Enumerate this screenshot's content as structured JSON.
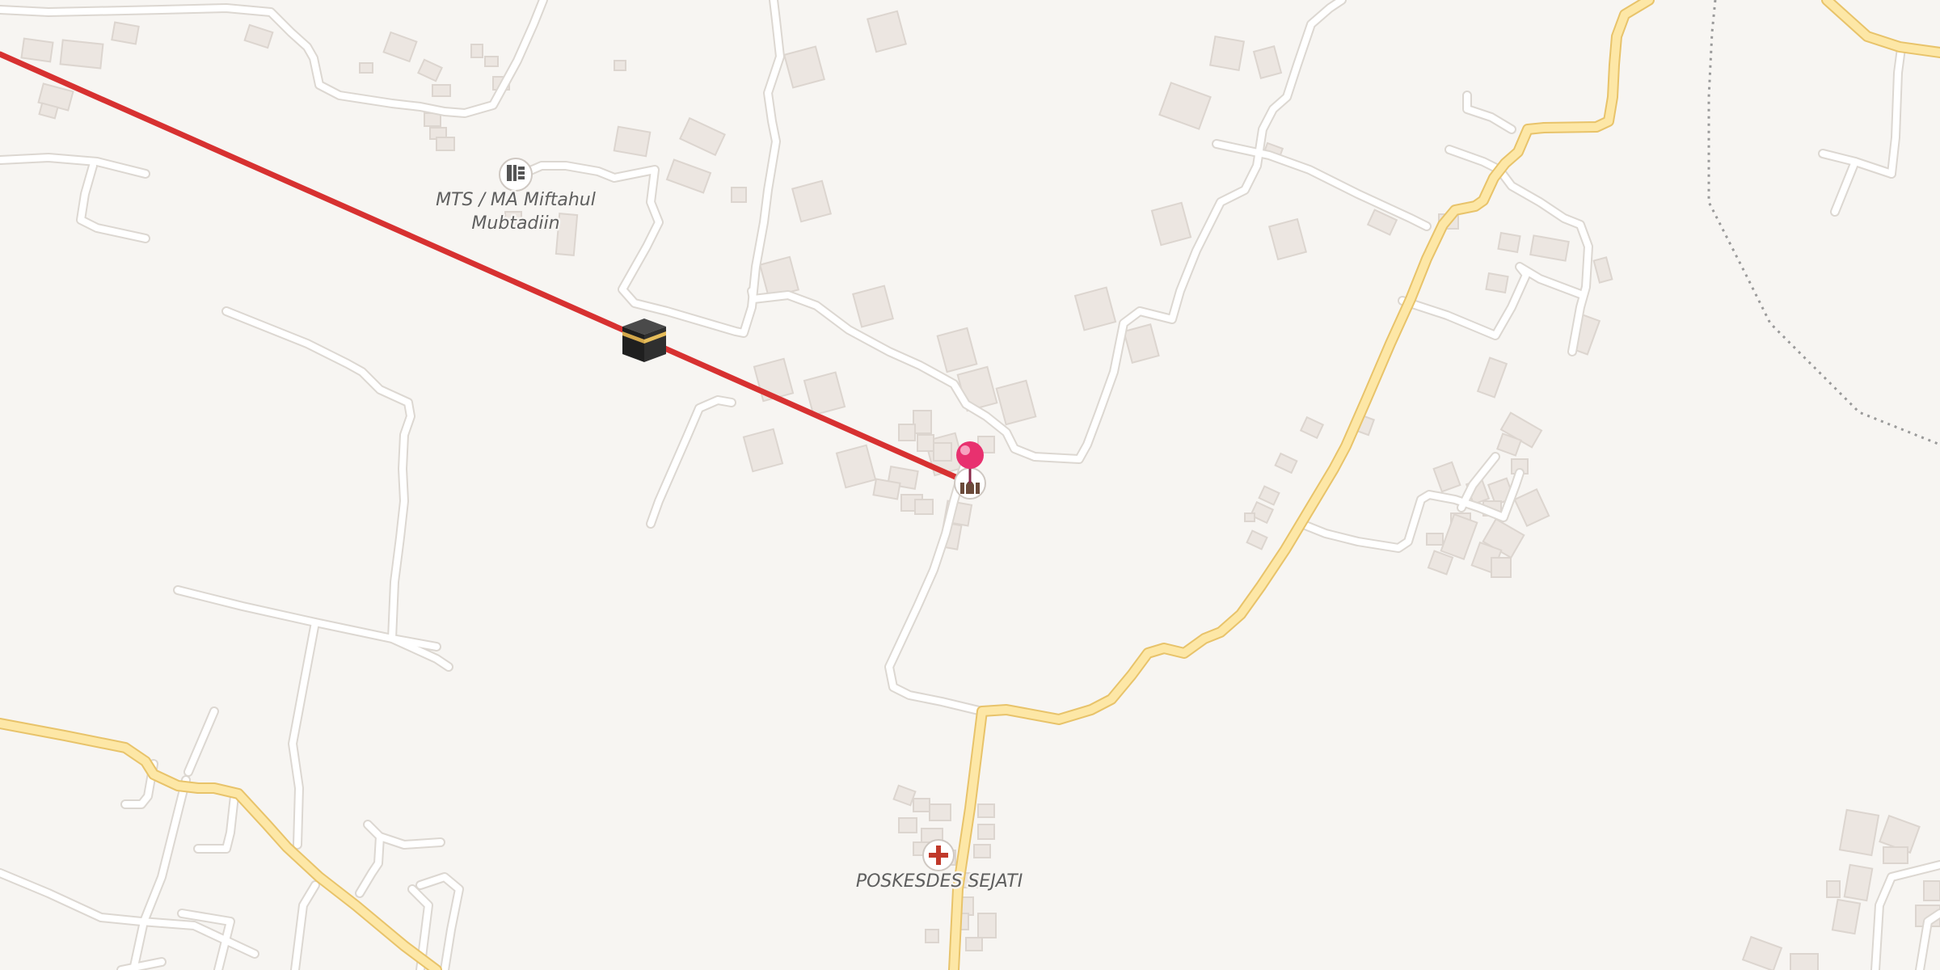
{
  "map": {
    "colors": {
      "background": "#f7f5f2",
      "minor_road": "#ffffff",
      "minor_road_casing": "#dcd7d1",
      "primary_road": "#fde7a6",
      "primary_road_casing": "#e8c36a",
      "building": "#ece6e1",
      "building_edge": "#dcd5cf",
      "qibla_line": "#d73131",
      "location_pin": "#e8316f",
      "boundary": "#9a9a9a",
      "health_cross": "#c0392b"
    },
    "overlay": {
      "line_icon": "kaaba-icon",
      "pin_icon": "location-pin-icon"
    },
    "pois": [
      {
        "name": "MTS / MA Miftahul",
        "name_line2": "Mubtadiin",
        "icon": "school-icon"
      },
      {
        "name": "",
        "icon": "mosque-icon"
      },
      {
        "name": "POSKESDES SEJATI",
        "icon": "health-cross-icon"
      }
    ]
  }
}
